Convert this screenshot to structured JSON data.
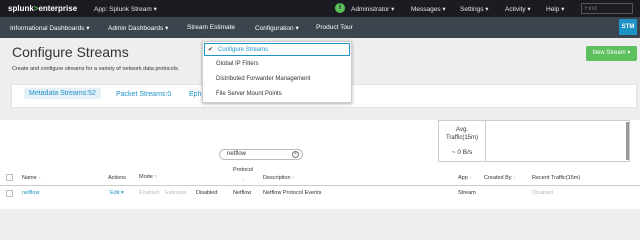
{
  "topbar": {
    "logo_prefix": "splunk",
    "logo_gt": ">",
    "logo_suffix": "enterprise",
    "app": "App: Splunk Stream ▾",
    "info_glyph": "i",
    "user": "Administrator ▾",
    "messages": "Messages ▾",
    "settings": "Settings ▾",
    "activity": "Activity ▾",
    "help": "Help ▾",
    "find_placeholder": "Find"
  },
  "navbar": {
    "items": [
      {
        "label": "Informational Dashboards ▾"
      },
      {
        "label": "Admin Dashboards ▾"
      },
      {
        "label": "Stream Estimate"
      },
      {
        "label": "Configuration ▾"
      },
      {
        "label": "Product Tour"
      }
    ],
    "badge": "STM"
  },
  "page": {
    "title": "Configure Streams",
    "subtitle": "Create and configure streams for a variety of network data protocols.",
    "new_stream_button": "New Stream ▾"
  },
  "dropdown": {
    "items": [
      {
        "label": "Configure Streams",
        "checked": true
      },
      {
        "label": "Global IP Filters"
      },
      {
        "label": "Distributed Forwarder Management"
      },
      {
        "label": "File Server Mount Points"
      }
    ],
    "check_glyph": "✔"
  },
  "stream_tabs": [
    {
      "label": "Metadata Streams:52"
    },
    {
      "label": "Packet Streams:0"
    },
    {
      "label": "Ephe"
    }
  ],
  "traffic": {
    "label_line1": "Avg.",
    "label_line2": "Traffic(15m)",
    "value": "~ 0 B/s"
  },
  "search": {
    "value": "netflow",
    "clear_glyph": "×"
  },
  "table": {
    "columns": {
      "name": "Name",
      "actions": "Actions",
      "mode": "Mode",
      "protocol_line1": "Protocol",
      "protocol_line2": "÷",
      "description": "Description",
      "app": "App",
      "created_by": "Created By",
      "recent_traffic": "Recent Traffic(15m)"
    },
    "sort_glyph": "÷",
    "help_glyph": "?",
    "rows": [
      {
        "name": "netflow",
        "action": "Edit ▾",
        "mode_enabled": "Enabled",
        "mode_estimate": "Estimate",
        "mode_disabled": "Disabled",
        "protocol": "Netflow",
        "description": "Netflow Protocol Events",
        "app": "Stream",
        "created_by": "",
        "recent_traffic": "Disabled"
      }
    ]
  }
}
